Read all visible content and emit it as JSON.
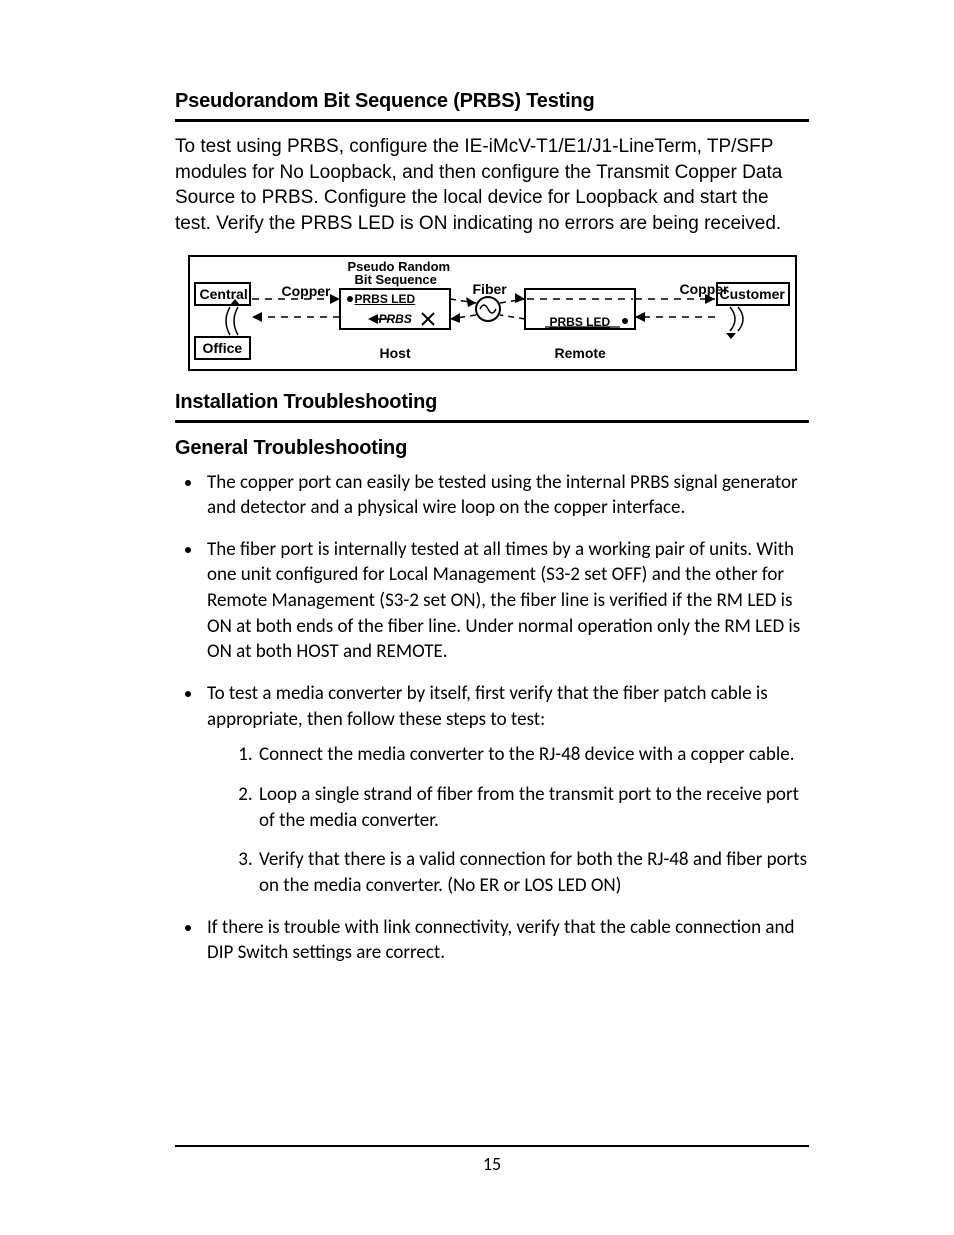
{
  "section1": {
    "title": "Pseudorandom Bit Sequence (PRBS) Testing",
    "body": "To test using PRBS, configure the IE-iMcV-T1/E1/J1-LineTerm, TP/SFP modules for No Loopback, and then configure the Transmit Copper Data Source to PRBS.  Configure the local device for Loopback and start the test.  Verify the PRBS LED is ON indicating no errors are being received."
  },
  "diagram": {
    "title1": "Pseudo Random",
    "title2": "Bit Sequence",
    "left_top": "Central",
    "left_bottom": "Office",
    "right_box": "Customer",
    "copper_l": "Copper",
    "copper_r": "Copper",
    "fiber": "Fiber",
    "host": "Host",
    "remote": "Remote",
    "prbs": "PRBS",
    "prbs_led_l": "PRBS LED",
    "prbs_led_r": "PRBS LED"
  },
  "section2": {
    "title": "Installation Troubleshooting",
    "subhead": "General Troubleshooting",
    "bullets": [
      "The copper port can easily be tested using the internal PRBS signal generator and detector and a physical wire loop on the copper interface.",
      "The fiber port is internally tested at all times by a working pair of units.  With one unit configured for Local Management (S3-2 set OFF) and the other for Remote Management (S3-2 set ON), the fiber line is verified if the RM LED is ON at both ends of the fiber line.  Under normal operation only the RM LED is ON at both HOST and REMOTE.",
      "To test a media converter by itself, first verify that the fiber patch cable is appropriate, then follow these steps to test:",
      "If there is trouble with link connectivity, verify that the cable connection and DIP Switch settings are correct."
    ],
    "steps": [
      "Connect the media converter to the RJ-48 device with a copper cable.",
      "Loop a single strand of fiber from the transmit port to the receive port of the media converter.",
      "Verify that there is a valid connection for both the RJ-48 and fiber ports on the media converter. (No ER or LOS LED ON)"
    ]
  },
  "page_number": "15"
}
